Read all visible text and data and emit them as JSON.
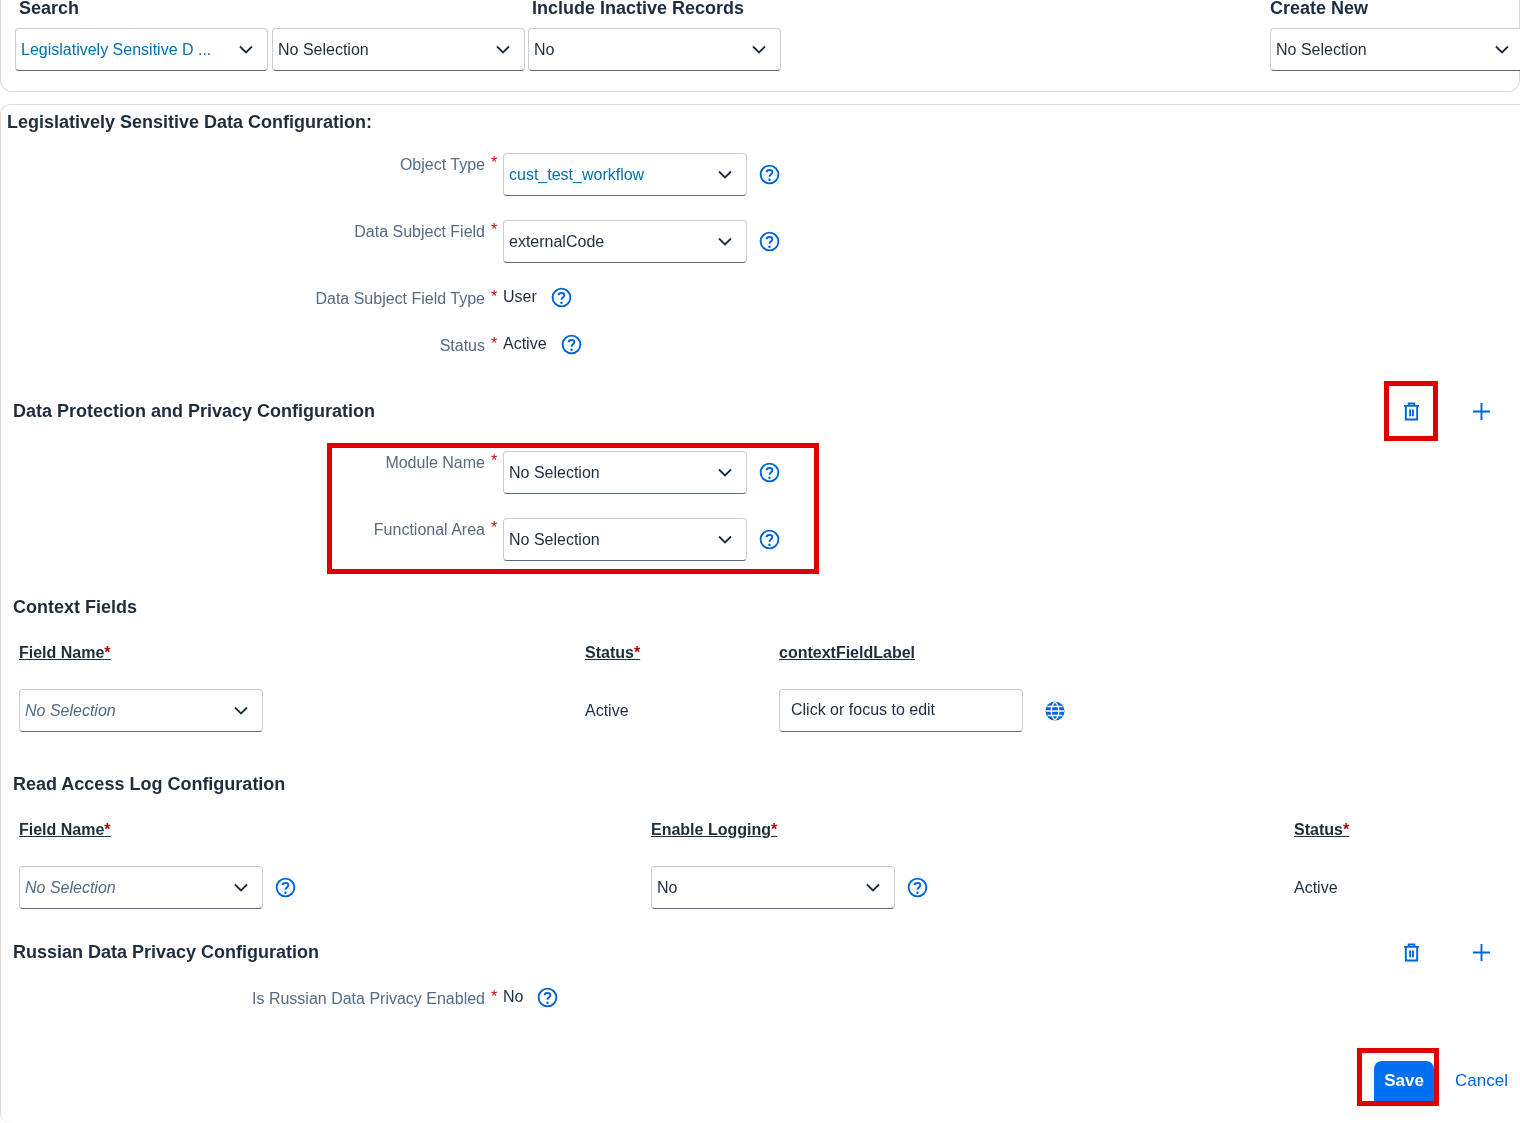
{
  "search_bar": {
    "filters": [
      {
        "label": "Search",
        "value": "Legislatively Sensitive D  ...",
        "kind": "lookup"
      },
      {
        "value": "No Selection",
        "kind": "select"
      },
      {
        "label": "Include Inactive Records",
        "value": "No",
        "kind": "select"
      }
    ],
    "create_new": {
      "label": "Create New",
      "value": "No Selection"
    }
  },
  "config": {
    "title": "Legislatively Sensitive Data Configuration:",
    "fields": [
      {
        "label": "Object Type",
        "required_mark": "*",
        "kind": "lookup",
        "value": "cust_test_workflow"
      },
      {
        "label": "Data Subject Field",
        "required_mark": "*",
        "kind": "select",
        "value": "externalCode"
      },
      {
        "label": "Data Subject Field Type",
        "required_mark": "*",
        "kind": "text",
        "value": "User"
      },
      {
        "label": "Status",
        "required_mark": "*",
        "kind": "text",
        "value": "Active"
      }
    ]
  },
  "dpp": {
    "title": "Data Protection and Privacy Configuration",
    "fields_highlighted": true,
    "actions": [
      {
        "kind": "delete",
        "highlighted": true
      },
      {
        "kind": "add"
      }
    ],
    "fields": [
      {
        "label": "Module Name",
        "required_mark": "*",
        "kind": "select",
        "value": "No Selection"
      },
      {
        "label": "Functional Area",
        "required_mark": "*",
        "kind": "select",
        "value": "No Selection"
      }
    ]
  },
  "context_fields": {
    "title": "Context Fields",
    "columns": [
      {
        "label": "Field Name",
        "required_mark": "*"
      },
      {
        "label": "Status",
        "required_mark": "*"
      },
      {
        "label": "contextFieldLabel"
      }
    ],
    "row": {
      "field_name": {
        "placeholder": "No Selection"
      },
      "status": "Active",
      "label_value": "Click or focus to edit"
    }
  },
  "read_access_log": {
    "title": "Read Access Log Configuration",
    "columns": [
      {
        "label": "Field Name",
        "required_mark": "*"
      },
      {
        "label": "Enable Logging",
        "required_mark": "*"
      },
      {
        "label": "Status",
        "required_mark": "*"
      }
    ],
    "row": {
      "field_name": {
        "placeholder": "No Selection"
      },
      "enable_logging": "No",
      "status": "Active"
    }
  },
  "russian": {
    "title": "Russian Data Privacy Configuration",
    "actions": [
      {
        "kind": "delete"
      },
      {
        "kind": "add"
      }
    ],
    "fields": [
      {
        "label": "Is Russian Data Privacy Enabled",
        "required_mark": "*",
        "kind": "text",
        "value": "No"
      }
    ]
  },
  "footer": {
    "save": {
      "label": "Save",
      "highlighted": true
    },
    "cancel": {
      "label": "Cancel"
    }
  }
}
